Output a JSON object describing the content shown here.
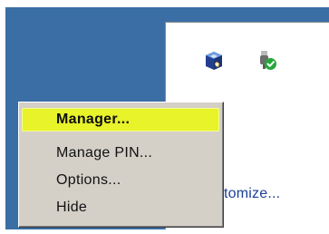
{
  "tray": {
    "customize_text": "tomize..."
  },
  "menu": {
    "items": [
      {
        "label": "Manager..."
      },
      {
        "label": "Manage PIN..."
      },
      {
        "label": "Options..."
      },
      {
        "label": "Hide"
      }
    ]
  },
  "colors": {
    "desktop_blue": "#3a6ea5",
    "menu_face": "#d4d0c8",
    "highlight": "#e8f32a",
    "link_blue": "#1b3f9a",
    "check_green": "#27a63a"
  },
  "icons": {
    "tray_left": "virtualbox-icon",
    "tray_right": "usb-safe-remove-icon"
  }
}
